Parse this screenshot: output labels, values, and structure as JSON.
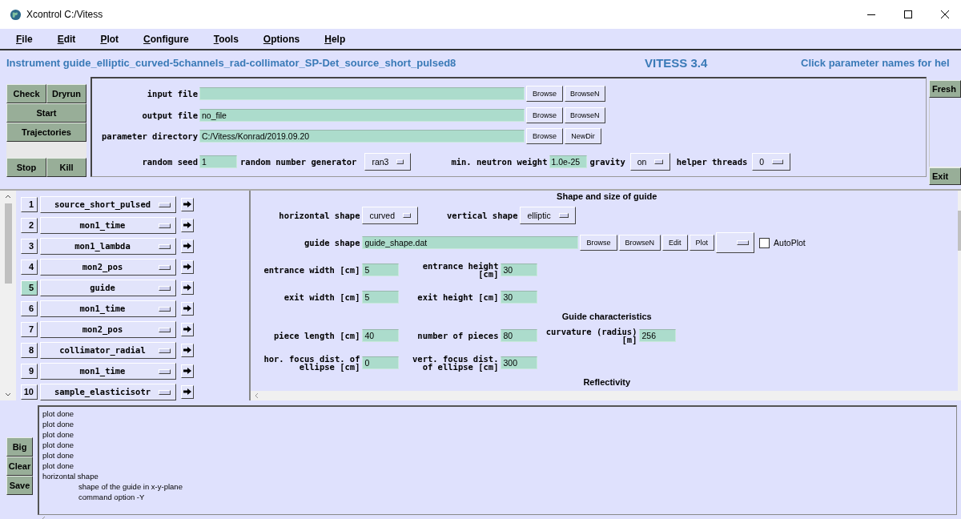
{
  "window": {
    "title": "Xcontrol C:/Vitess"
  },
  "menu": [
    {
      "label": "File"
    },
    {
      "label": "Edit"
    },
    {
      "label": "Plot"
    },
    {
      "label": "Configure"
    },
    {
      "label": "Tools"
    },
    {
      "label": "Options"
    },
    {
      "label": "Help"
    }
  ],
  "instrument": {
    "title": "Instrument guide_elliptic_curved-5channels_rad-collimator_SP-Det_source_short_pulsed8",
    "version": "VITESS 3.4",
    "hint": "Click parameter names for hel"
  },
  "run_buttons": {
    "check": "Check",
    "dryrun": "Dryrun",
    "start": "Start",
    "trajectories": "Trajectories",
    "stop": "Stop",
    "kill": "Kill"
  },
  "file_fields": [
    {
      "label": "input file",
      "buttons": [
        "Browse",
        "BrowseN"
      ]
    },
    {
      "label": "output file",
      "value": "no_file",
      "buttons": [
        "Browse",
        "BrowseN"
      ]
    },
    {
      "label": "parameter directory",
      "value": "C:/Vitess/Konrad/2019.09.20",
      "buttons": [
        "Browse",
        "NewDir"
      ]
    }
  ],
  "settings": [
    {
      "label": "random seed",
      "kind": "input",
      "value": "1"
    },
    {
      "label": "random number generator",
      "kind": "select",
      "value": "ran3"
    },
    {
      "label": "min. neutron weight",
      "kind": "input",
      "value": "1.0e-25"
    },
    {
      "label": "gravity",
      "kind": "select",
      "value": "on"
    },
    {
      "label": "helper threads",
      "kind": "select",
      "value": "0"
    }
  ],
  "side_buttons": {
    "fresh": "Fresh",
    "exit": "Exit"
  },
  "modules": [
    {
      "number": "1",
      "name": "source_short_pulsed",
      "selected": false
    },
    {
      "number": "2",
      "name": "mon1_time",
      "selected": false
    },
    {
      "number": "3",
      "name": "mon1_lambda",
      "selected": false
    },
    {
      "number": "4",
      "name": "mon2_pos",
      "selected": false
    },
    {
      "number": "5",
      "name": "guide",
      "selected": true
    },
    {
      "number": "6",
      "name": "mon1_time",
      "selected": false
    },
    {
      "number": "7",
      "name": "mon2_pos",
      "selected": false
    },
    {
      "number": "8",
      "name": "collimator_radial",
      "selected": false
    },
    {
      "number": "9",
      "name": "mon1_time",
      "selected": false
    },
    {
      "number": "10",
      "name": "sample_elasticisotr",
      "selected": false
    }
  ],
  "parameters": [
    {
      "heading": "Shape and size of guide",
      "rows": [
        [
          {
            "label": "horizontal shape",
            "kind": "select",
            "value": "curved"
          },
          {
            "label": "vertical shape",
            "kind": "select",
            "value": "elliptic"
          }
        ],
        [
          {
            "label": "guide shape",
            "kind": "file",
            "value": "guide_shape.dat",
            "buttons": [
              "Browse",
              "BrowseN",
              "Edit",
              "Plot"
            ],
            "autoplot": {
              "label": "AutoPlot",
              "checked": false
            }
          }
        ],
        [
          {
            "label": "entrance width [cm]",
            "kind": "input",
            "value": "5"
          },
          {
            "label": "entrance height [cm]",
            "kind": "input",
            "value": "30"
          }
        ],
        [
          {
            "label": "exit width [cm]",
            "kind": "input",
            "value": "5"
          },
          {
            "label": "exit height [cm]",
            "kind": "input",
            "value": "30"
          }
        ]
      ]
    },
    {
      "heading": "Guide characteristics",
      "rows": [
        [
          {
            "label": "piece length [cm]",
            "kind": "input",
            "value": "40"
          },
          {
            "label": "number of pieces",
            "kind": "input",
            "value": "80"
          },
          {
            "label": "curvature (radius) [m]",
            "kind": "input",
            "value": "256"
          }
        ],
        [
          {
            "label": "hor. focus dist. of ellipse [cm]",
            "kind": "input",
            "value": "0"
          },
          {
            "label": "vert. focus dist. of ellipse [cm]",
            "kind": "input",
            "value": "300"
          }
        ]
      ]
    },
    {
      "heading": "Reflectivity"
    }
  ],
  "log_buttons": [
    "Big",
    "Clear",
    "Save"
  ],
  "log": [
    {
      "text": "plot done"
    },
    {
      "text": "plot done"
    },
    {
      "text": "plot done"
    },
    {
      "text": "plot done"
    },
    {
      "text": "plot done"
    },
    {
      "text": "plot done"
    },
    {
      "text": "horizontal shape",
      "children": [
        {
          "text": "shape of the guide in x-y-plane"
        },
        {
          "text": "command option -Y"
        }
      ]
    }
  ]
}
